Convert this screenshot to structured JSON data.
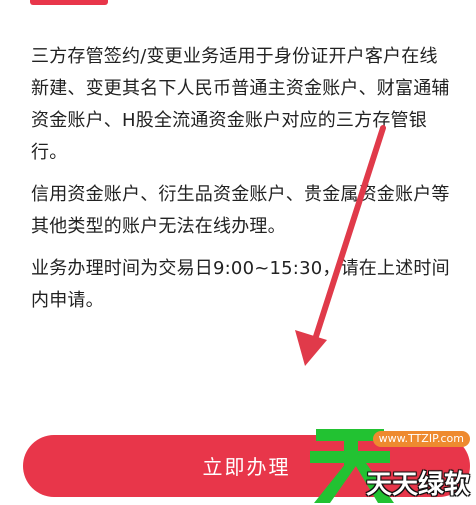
{
  "content": {
    "paragraphs": [
      "三方存管签约/变更业务适用于身份证开户客户在线新建、变更其名下人民币普通主资金账户、财富通辅资金账户、H股全流通资金账户对应的三方存管银行。",
      "信用资金账户、衍生品资金账户、贵金属资金账户等其他类型的账户无法在线办理。",
      "业务办理时间为交易日9:00~15:30，请在上述时间内申请。"
    ]
  },
  "action": {
    "button_label": "立即办理"
  },
  "watermark": {
    "url": "www.TTZIP.com",
    "text": "天天绿软"
  },
  "colors": {
    "accent": "#e8364a",
    "annotation_arrow": "#e03a4a",
    "watermark_green": "#22c232"
  }
}
